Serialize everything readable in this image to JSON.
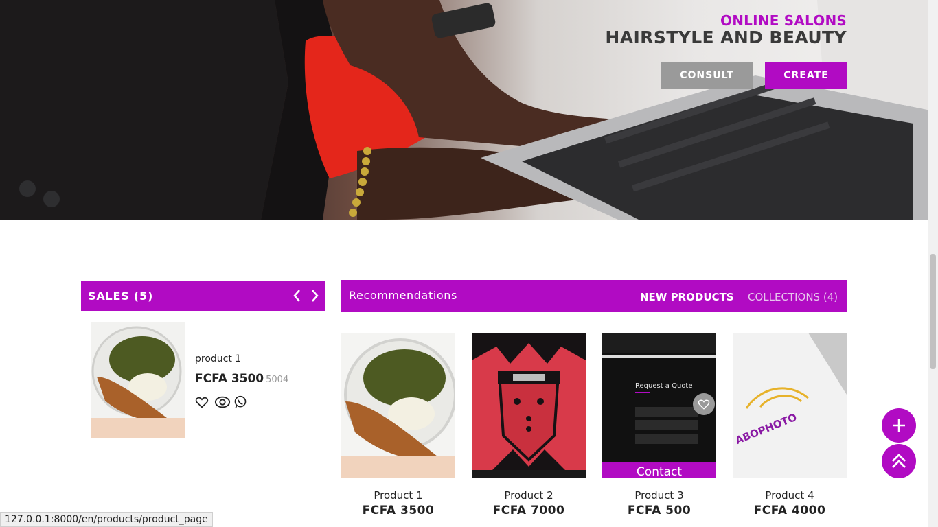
{
  "hero": {
    "subtitle": "ONLINE SALONS",
    "title": "HAIRSTYLE AND BEAUTY",
    "consult_label": "CONSULT",
    "create_label": "CREATE"
  },
  "sales": {
    "title": "SALES (5)",
    "item": {
      "name": "product 1",
      "price": "FCFA 3500",
      "old_price": "5004"
    }
  },
  "recommendations": {
    "title": "Recommendations",
    "tab_new": "NEW PRODUCTS",
    "tab_collections": "COLLECTIONS (4)",
    "products": [
      {
        "name": "Product 1",
        "price": "FCFA 3500"
      },
      {
        "name": "Product 2",
        "price": "FCFA 7000"
      },
      {
        "name": "Product 3",
        "price": "FCFA 500",
        "overlay_label": "Contact",
        "image_text": "Request a Quote"
      },
      {
        "name": "Product 4",
        "price": "FCFA 4000",
        "image_text": "ABOPHOTO"
      }
    ]
  },
  "status_url": "127.0.0.1:8000/en/products/product_page",
  "colors": {
    "accent": "#b10bc3",
    "grey_button": "#9a9a9a"
  }
}
